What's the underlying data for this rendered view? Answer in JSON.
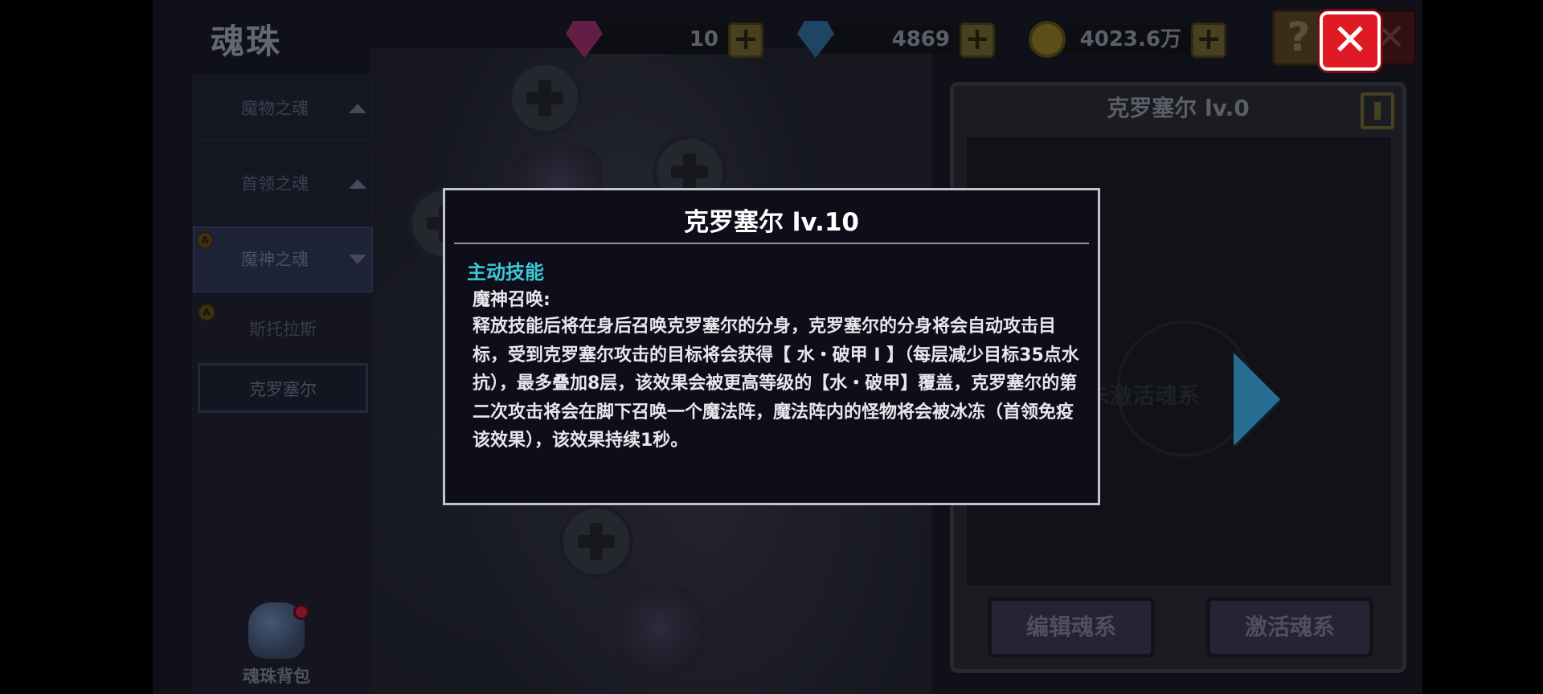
{
  "screen": {
    "title": "魂珠"
  },
  "currencies": [
    {
      "icon": "pink-gem-icon",
      "value": "10"
    },
    {
      "icon": "blue-gem-icon",
      "value": "4869"
    },
    {
      "icon": "gold-coin-icon",
      "value": "4023.6万"
    }
  ],
  "colors": {
    "dialog_section": "#3ec7d8",
    "close_button": "#e01a24",
    "arrow": "#3ea7e0"
  },
  "sidebar": {
    "categories": [
      {
        "label": "魔物之魂",
        "state": "collapsed"
      },
      {
        "label": "首领之魂",
        "state": "collapsed"
      },
      {
        "label": "魔神之魂",
        "state": "expanded"
      }
    ],
    "sub_items": [
      {
        "label": "斯托拉斯"
      },
      {
        "label": "克罗塞尔"
      }
    ],
    "bag_label": "魂珠背包"
  },
  "right_panel": {
    "title": "克罗塞尔 lv.0",
    "ghost_text": "未激活魂系",
    "buttons": {
      "edit": "编辑魂系",
      "activate": "激活魂系"
    }
  },
  "dialog": {
    "title": "克罗塞尔 lv.10",
    "section_label": "主动技能",
    "skill_name": "魔神召唤:",
    "description": "释放技能后将在身后召唤克罗塞尔的分身，克罗塞尔的分身将会自动攻击目标，受到克罗塞尔攻击的目标将会获得【 水・破甲 Ⅰ 】（每层减少目标35点水抗），最多叠加8层，该效果会被更高等级的【水・破甲】覆盖，克罗塞尔的第二次攻击将会在脚下召唤一个魔法阵，魔法阵内的怪物将会被冰冻（首领免疫该效果），该效果持续1秒。"
  }
}
